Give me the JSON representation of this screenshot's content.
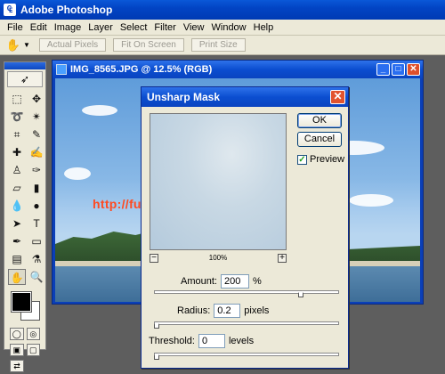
{
  "app": {
    "title": "Adobe Photoshop"
  },
  "menu": [
    "File",
    "Edit",
    "Image",
    "Layer",
    "Select",
    "Filter",
    "View",
    "Window",
    "Help"
  ],
  "options_bar": {
    "buttons": [
      "Actual Pixels",
      "Fit On Screen",
      "Print Size"
    ]
  },
  "document": {
    "title": "IMG_8565.JPG @ 12.5% (RGB)"
  },
  "watermark": "http://functionaltextiles.bloggang.com",
  "dialog": {
    "title": "Unsharp Mask",
    "ok": "OK",
    "cancel": "Cancel",
    "preview_label": "Preview",
    "preview_checked": true,
    "zoom": "100%",
    "zoom_minus": "−",
    "zoom_plus": "+",
    "amount": {
      "label": "Amount:",
      "value": "200",
      "unit": "%",
      "level": 0.8
    },
    "radius": {
      "label": "Radius:",
      "value": "0.2",
      "unit": "pixels",
      "level": 0.0
    },
    "threshold": {
      "label": "Threshold:",
      "value": "0",
      "unit": "levels",
      "level": 0.0
    }
  },
  "icons": {
    "app_logo": "photoshop-logo-icon",
    "check": "✓",
    "close": "✕"
  }
}
